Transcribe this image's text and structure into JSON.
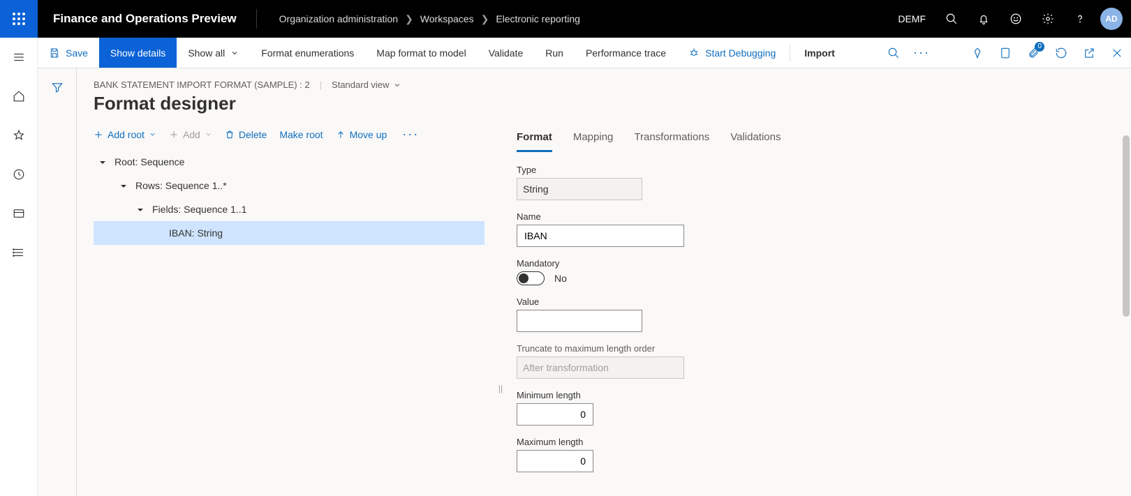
{
  "header": {
    "app_title": "Finance and Operations Preview",
    "breadcrumbs": [
      "Organization administration",
      "Workspaces",
      "Electronic reporting"
    ],
    "entity": "DEMF",
    "avatar": "AD"
  },
  "action_bar": {
    "save": "Save",
    "show_details": "Show details",
    "show_all": "Show all",
    "format_enum": "Format enumerations",
    "map_format": "Map format to model",
    "validate": "Validate",
    "run": "Run",
    "perf_trace": "Performance trace",
    "start_debug": "Start Debugging",
    "import": "Import",
    "badge_count": "0"
  },
  "page": {
    "config_name": "BANK STATEMENT IMPORT FORMAT (SAMPLE) : 2",
    "view_label": "Standard view",
    "title": "Format designer"
  },
  "tree_toolbar": {
    "add_root": "Add root",
    "add": "Add",
    "delete": "Delete",
    "make_root": "Make root",
    "move_up": "Move up"
  },
  "tree": {
    "n0": "Root: Sequence",
    "n1": "Rows: Sequence 1..*",
    "n2": "Fields: Sequence 1..1",
    "n3": "IBAN: String"
  },
  "tabs": {
    "format": "Format",
    "mapping": "Mapping",
    "transformations": "Transformations",
    "validations": "Validations"
  },
  "props": {
    "type_label": "Type",
    "type_value": "String",
    "name_label": "Name",
    "name_value": "IBAN",
    "mandatory_label": "Mandatory",
    "mandatory_value": "No",
    "value_label": "Value",
    "value_value": "",
    "truncate_label": "Truncate to maximum length order",
    "truncate_value": "After transformation",
    "min_label": "Minimum length",
    "min_value": "0",
    "max_label": "Maximum length",
    "max_value": "0"
  }
}
